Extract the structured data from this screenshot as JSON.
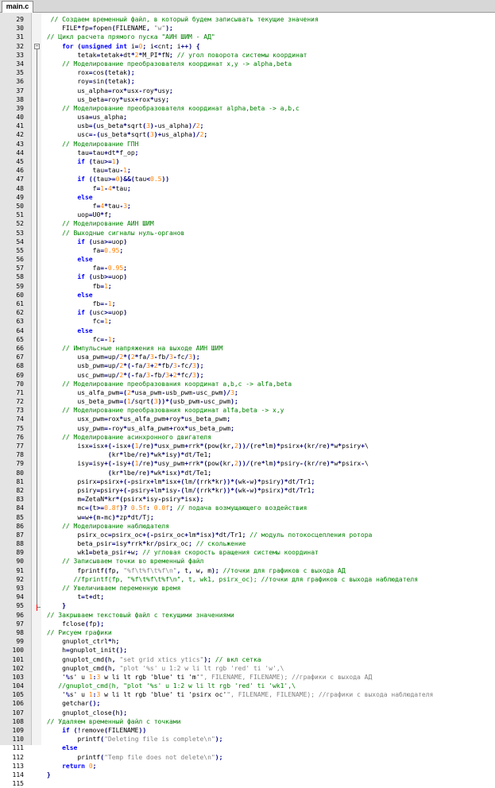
{
  "tab": {
    "label": "main.c"
  },
  "fold_markers": {
    "open_line": "32",
    "close_line": "95",
    "sign": "−"
  },
  "lines": [
    {
      "n": "29",
      "t": "  // Создаем временный файл, в который будем записывать текущие значения"
    },
    {
      "n": "30",
      "t": "     FILE*fp=fopen(FILENAME, \"w\");"
    },
    {
      "n": "31",
      "t": " // Цикл расчета прямого пуска \"АИН ШИМ - АД\""
    },
    {
      "n": "32",
      "t": "     for (unsigned int i=0; i<cnt; i++) {"
    },
    {
      "n": "33",
      "t": "         tetak=tetak+dt*2*M_PI*fN; // угол поворота системы координат"
    },
    {
      "n": "34",
      "t": "     // Моделирование преобразователя координат x,y -> alpha,beta"
    },
    {
      "n": "35",
      "t": "         rox=cos(tetak);"
    },
    {
      "n": "36",
      "t": "         roy=sin(tetak);"
    },
    {
      "n": "37",
      "t": "         us_alpha=rox*usx-roy*usy;"
    },
    {
      "n": "38",
      "t": "         us_beta=roy*usx+rox*usy;"
    },
    {
      "n": "39",
      "t": "     // Моделирование преобразователя координат alpha,beta -> a,b,c"
    },
    {
      "n": "40",
      "t": "         usa=us_alpha;"
    },
    {
      "n": "41",
      "t": "         usb=(us_beta*sqrt(3)-us_alpha)/2;"
    },
    {
      "n": "42",
      "t": "         usc=-(us_beta*sqrt(3)+us_alpha)/2;"
    },
    {
      "n": "43",
      "t": "     // Моделирование ГПН"
    },
    {
      "n": "44",
      "t": "         tau=tau+dt*f_op;"
    },
    {
      "n": "45",
      "t": "         if (tau>=1)"
    },
    {
      "n": "46",
      "t": "             tau=tau-1;"
    },
    {
      "n": "47",
      "t": "         if ((tau>=0)&&(tau<0.5))"
    },
    {
      "n": "48",
      "t": "             f=1-4*tau;"
    },
    {
      "n": "49",
      "t": "         else"
    },
    {
      "n": "50",
      "t": "             f=4*tau-3;"
    },
    {
      "n": "51",
      "t": "         uop=U0*f;"
    },
    {
      "n": "52",
      "t": "     // Моделирование АИН ШИМ"
    },
    {
      "n": "53",
      "t": "     // Выходные сигналы нуль-органов"
    },
    {
      "n": "54",
      "t": "         if (usa>=uop)"
    },
    {
      "n": "55",
      "t": "             fa=0.95;"
    },
    {
      "n": "56",
      "t": "         else"
    },
    {
      "n": "57",
      "t": "             fa=-0.95;"
    },
    {
      "n": "58",
      "t": "         if (usb>=uop)"
    },
    {
      "n": "59",
      "t": "             fb=1;"
    },
    {
      "n": "60",
      "t": "         else"
    },
    {
      "n": "61",
      "t": "             fb=-1;"
    },
    {
      "n": "62",
      "t": "         if (usc>=uop)"
    },
    {
      "n": "63",
      "t": "             fc=1;"
    },
    {
      "n": "64",
      "t": "         else"
    },
    {
      "n": "65",
      "t": "             fc=-1;"
    },
    {
      "n": "66",
      "t": "     // Импульсные напряжения на выходе АИН ШИМ"
    },
    {
      "n": "67",
      "t": "         usa_pwm=up/2*(2*fa/3-fb/3-fc/3);"
    },
    {
      "n": "68",
      "t": "         usb_pwm=up/2*(-fa/3+2*fb/3-fc/3);"
    },
    {
      "n": "69",
      "t": "         usc_pwm=up/2*(-fa/3-fb/3+2*fc/3);"
    },
    {
      "n": "70",
      "t": "     // Моделирование преобразования координат a,b,c -> alfa,beta"
    },
    {
      "n": "71",
      "t": "         us_alfa_pwm=(2*usa_pwm-usb_pwm-usc_pwm)/3;"
    },
    {
      "n": "72",
      "t": "         us_beta_pwm=(1/sqrt(3))*(usb_pwm-usc_pwm);"
    },
    {
      "n": "73",
      "t": "     // Моделирование преобразования координат alfa,beta -> x,y"
    },
    {
      "n": "74",
      "t": "         usx_pwm=rox*us_alfa_pwm+roy*us_beta_pwm;"
    },
    {
      "n": "75",
      "t": "         usy_pwm=-roy*us_alfa_pwm+rox*us_beta_pwm;"
    },
    {
      "n": "76",
      "t": "     // Моделирование асинхронного двигателя"
    },
    {
      "n": "77",
      "t": "         isx=isx+(-isx+(1/re)*usx_pwm+rrk*(pow(kr,2))/(re*lm)*psirx+(kr/re)*w*psiry+\\"
    },
    {
      "n": "78",
      "t": "                 (kr*lbe/re)*wk*isy)*dt/Te1;"
    },
    {
      "n": "79",
      "t": "         isy=isy+(-isy+(1/re)*usy_pwm+rrk*(pow(kr,2))/(re*lm)*psiry-(kr/re)*w*psirx-\\"
    },
    {
      "n": "80",
      "t": "                 (kr*lbe/re)*wk*isx)*dt/Te1;"
    },
    {
      "n": "81",
      "t": "         psirx=psirx+(-psirx+lm*isx+(lm/(rrk*kr))*(wk-w)*psiry)*dt/Tr1;"
    },
    {
      "n": "82",
      "t": "         psiry=psiry+(-psiry+lm*isy-(lm/(rrk*kr))*(wk-w)*psirx)*dt/Tr1;"
    },
    {
      "n": "83",
      "t": "         m=ZetaN*kr*(psirx*isy-psiry*isx);"
    },
    {
      "n": "84",
      "t": "         mc=(t>=0.8f)? 0.5f: 0.0f; // подача возмущающего воздействия"
    },
    {
      "n": "85",
      "t": "         w=w+(m-mc)*zp*dt/Tj;"
    },
    {
      "n": "86",
      "t": "     // Моделирование наблюдателя"
    },
    {
      "n": "87",
      "t": "         psirx_oc=psirx_oc+(-psirx_oc+lm*isx)*dt/Tr1; // модуль потокосцепления ротора"
    },
    {
      "n": "88",
      "t": "         beta_psir=isy*rrk*kr/psirx_oc; // скольжение"
    },
    {
      "n": "89",
      "t": "         wk1=beta_psir+w; // угловая скорость вращения системы координат"
    },
    {
      "n": "90",
      "t": "     // Записываем точки во временный файл"
    },
    {
      "n": "91",
      "t": "         fprintf(fp, \"%f\\t%f\\t%f\\n\", t, w, m); //точки для графиков с выхода АД"
    },
    {
      "n": "92",
      "t": "        //fprintf(fp, \"%f\\t%f\\t%f\\n\", t, wk1, psirx_oc); //точки для графиков с выхода наблюдателя"
    },
    {
      "n": "93",
      "t": "     // Увеличиваем переменную время"
    },
    {
      "n": "94",
      "t": "         t=t+dt;"
    },
    {
      "n": "95",
      "t": "     }"
    },
    {
      "n": "96",
      "t": " // Закрываем текстовый файл с текущими значениями"
    },
    {
      "n": "97",
      "t": "     fclose(fp);"
    },
    {
      "n": "98",
      "t": " // Рисуем графики"
    },
    {
      "n": "99",
      "t": "     gnuplot_ctrl*h;"
    },
    {
      "n": "100",
      "t": "     h=gnuplot_init();"
    },
    {
      "n": "101",
      "t": "     gnuplot_cmd(h, \"set grid xtics ytics\"); // вкл сетка"
    },
    {
      "n": "102",
      "t": "     gnuplot_cmd(h, \"plot '%s' u 1:2 w li lt rgb 'red' ti 'w',\\"
    },
    {
      "n": "103",
      "t": "     '%s' u 1:3 w li lt rgb 'blue' ti 'm'\", FILENAME, FILENAME); //графики с выхода АД"
    },
    {
      "n": "104",
      "t": "    //gnuplot_cmd(h, \"plot '%s' u 1:2 w li lt rgb 'red' ti 'wk1',\\"
    },
    {
      "n": "105",
      "t": "     '%s' u 1:3 w li lt rgb 'blue' ti 'psirx oc'\", FILENAME, FILENAME); //графики с выхода наблюдателя"
    },
    {
      "n": "106",
      "t": "     getchar();"
    },
    {
      "n": "107",
      "t": "     gnuplot_close(h);"
    },
    {
      "n": "108",
      "t": " // Удаляем временный файл с точками"
    },
    {
      "n": "109",
      "t": "     if (!remove(FILENAME))"
    },
    {
      "n": "110",
      "t": "         printf(\"Deleting file is complete\\n\");"
    },
    {
      "n": "111",
      "t": "     else"
    },
    {
      "n": "112",
      "t": "         printf(\"Temp file does not delete\\n\");"
    },
    {
      "n": "113",
      "t": "     return 0;"
    },
    {
      "n": "114",
      "t": " }"
    },
    {
      "n": "115",
      "t": ""
    }
  ],
  "colors": {
    "keyword": "#0000ff",
    "comment": "#008000",
    "string": "#808080",
    "number": "#ff8000",
    "operator": "#000080"
  }
}
